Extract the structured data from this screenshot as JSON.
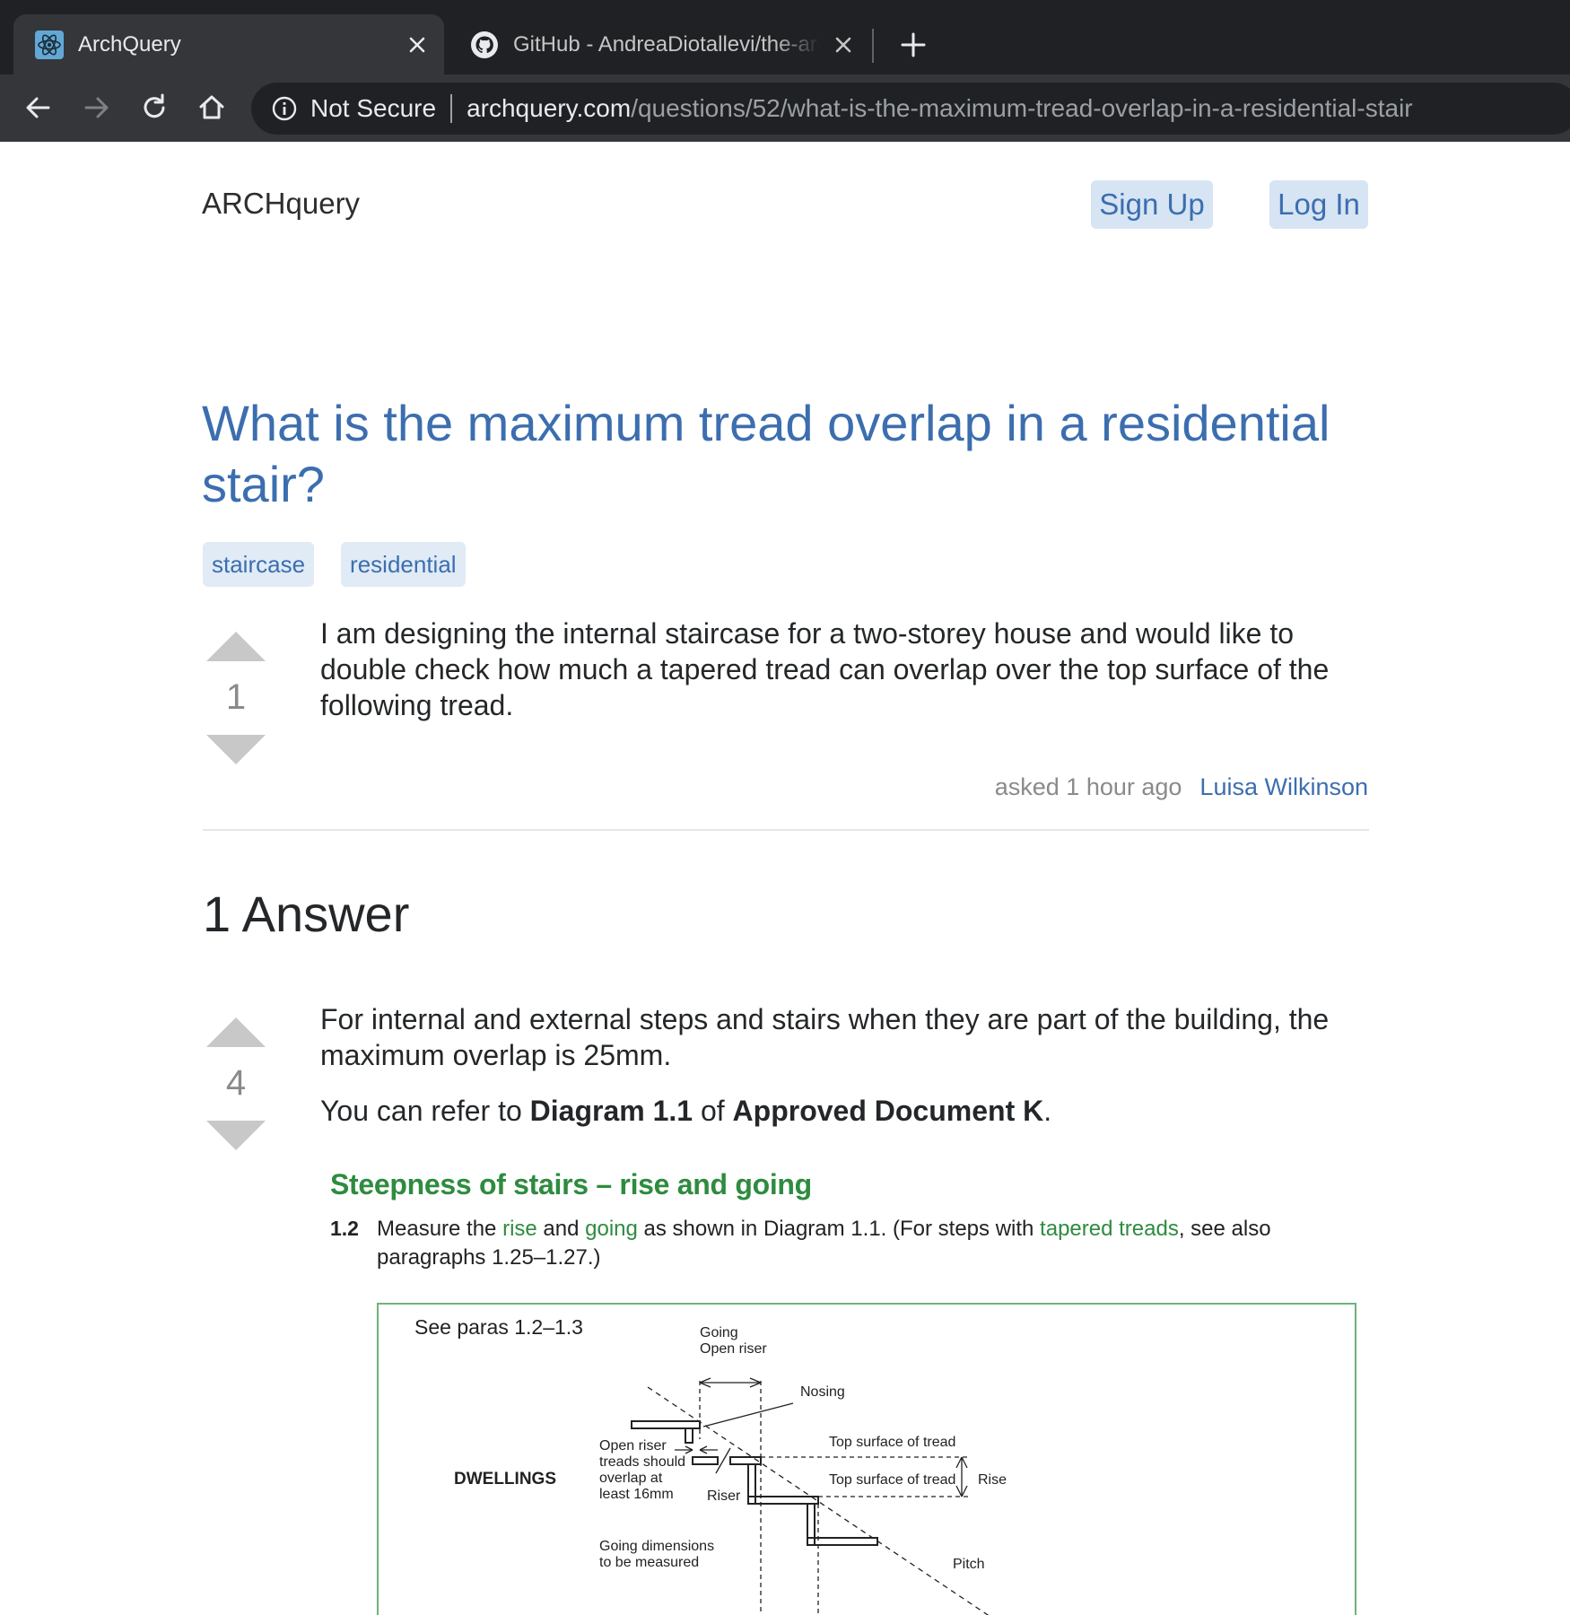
{
  "browser": {
    "tabs": [
      {
        "title": "ArchQuery",
        "active": true,
        "icon": "react-icon"
      },
      {
        "title": "GitHub - AndreaDiotallevi/the-architects-stack-exchange",
        "active": false,
        "icon": "github-icon"
      }
    ],
    "omnibox": {
      "security_label": "Not Secure",
      "host": "archquery.com",
      "path": "/questions/52/what-is-the-maximum-tread-overlap-in-a-residential-stair"
    }
  },
  "site": {
    "logo": "ARCHquery",
    "signup_label": "Sign Up",
    "login_label": "Log In"
  },
  "question": {
    "title": "What is the maximum tread overlap in a residential stair?",
    "tags": [
      "staircase",
      "residential"
    ],
    "votes": "1",
    "body": "I am designing the internal staircase for a two-storey house and would like to double check how much a tapered tread can overlap over the top surface of the following tread.",
    "asked": "asked 1 hour ago",
    "author": "Luisa Wilkinson"
  },
  "answers_heading": "1 Answer",
  "answer": {
    "votes": "4",
    "p1": "For internal and external steps and stairs when they are part of the building, the maximum overlap is 25mm.",
    "p2_prefix": "You can refer to ",
    "p2_bold1": "Diagram 1.1",
    "p2_mid": " of ",
    "p2_bold2": "Approved Document K",
    "p2_suffix": ".",
    "image": {
      "heading": "Steepness of stairs – rise and going",
      "para_num": "1.2",
      "para_a": "Measure the ",
      "para_rise": "rise",
      "para_and": " and ",
      "para_going": "going",
      "para_b": " as shown in Diagram 1.1. (For steps with ",
      "para_tapered": "tapered treads",
      "para_c": ", see also paragraphs 1.25–1.27.)",
      "diagram": {
        "see_paras": "See paras 1.2–1.3",
        "going_label_1": "Going",
        "going_label_2": "Open riser",
        "nosing": "Nosing",
        "open_riser_1": "Open riser",
        "open_riser_2": "treads should",
        "open_riser_3": "overlap at",
        "open_riser_4": "least 16mm",
        "dwellings": "DWELLINGS",
        "riser": "Riser",
        "top_surface_1": "Top surface of tread",
        "top_surface_2": "Top surface of tread",
        "rise": "Rise",
        "going_dims_1": "Going dimensions",
        "going_dims_2": "to be measured",
        "pitch": "Pitch"
      }
    }
  },
  "colors": {
    "chrome_bg": "#202124",
    "tab_active_bg": "#35363a",
    "link_blue": "#3c6eaf",
    "button_bg": "#d6e4f3",
    "tag_bg": "#e0ebf6",
    "vote_arrow": "#c8c8c8",
    "doc_green": "#2e8b3f"
  }
}
